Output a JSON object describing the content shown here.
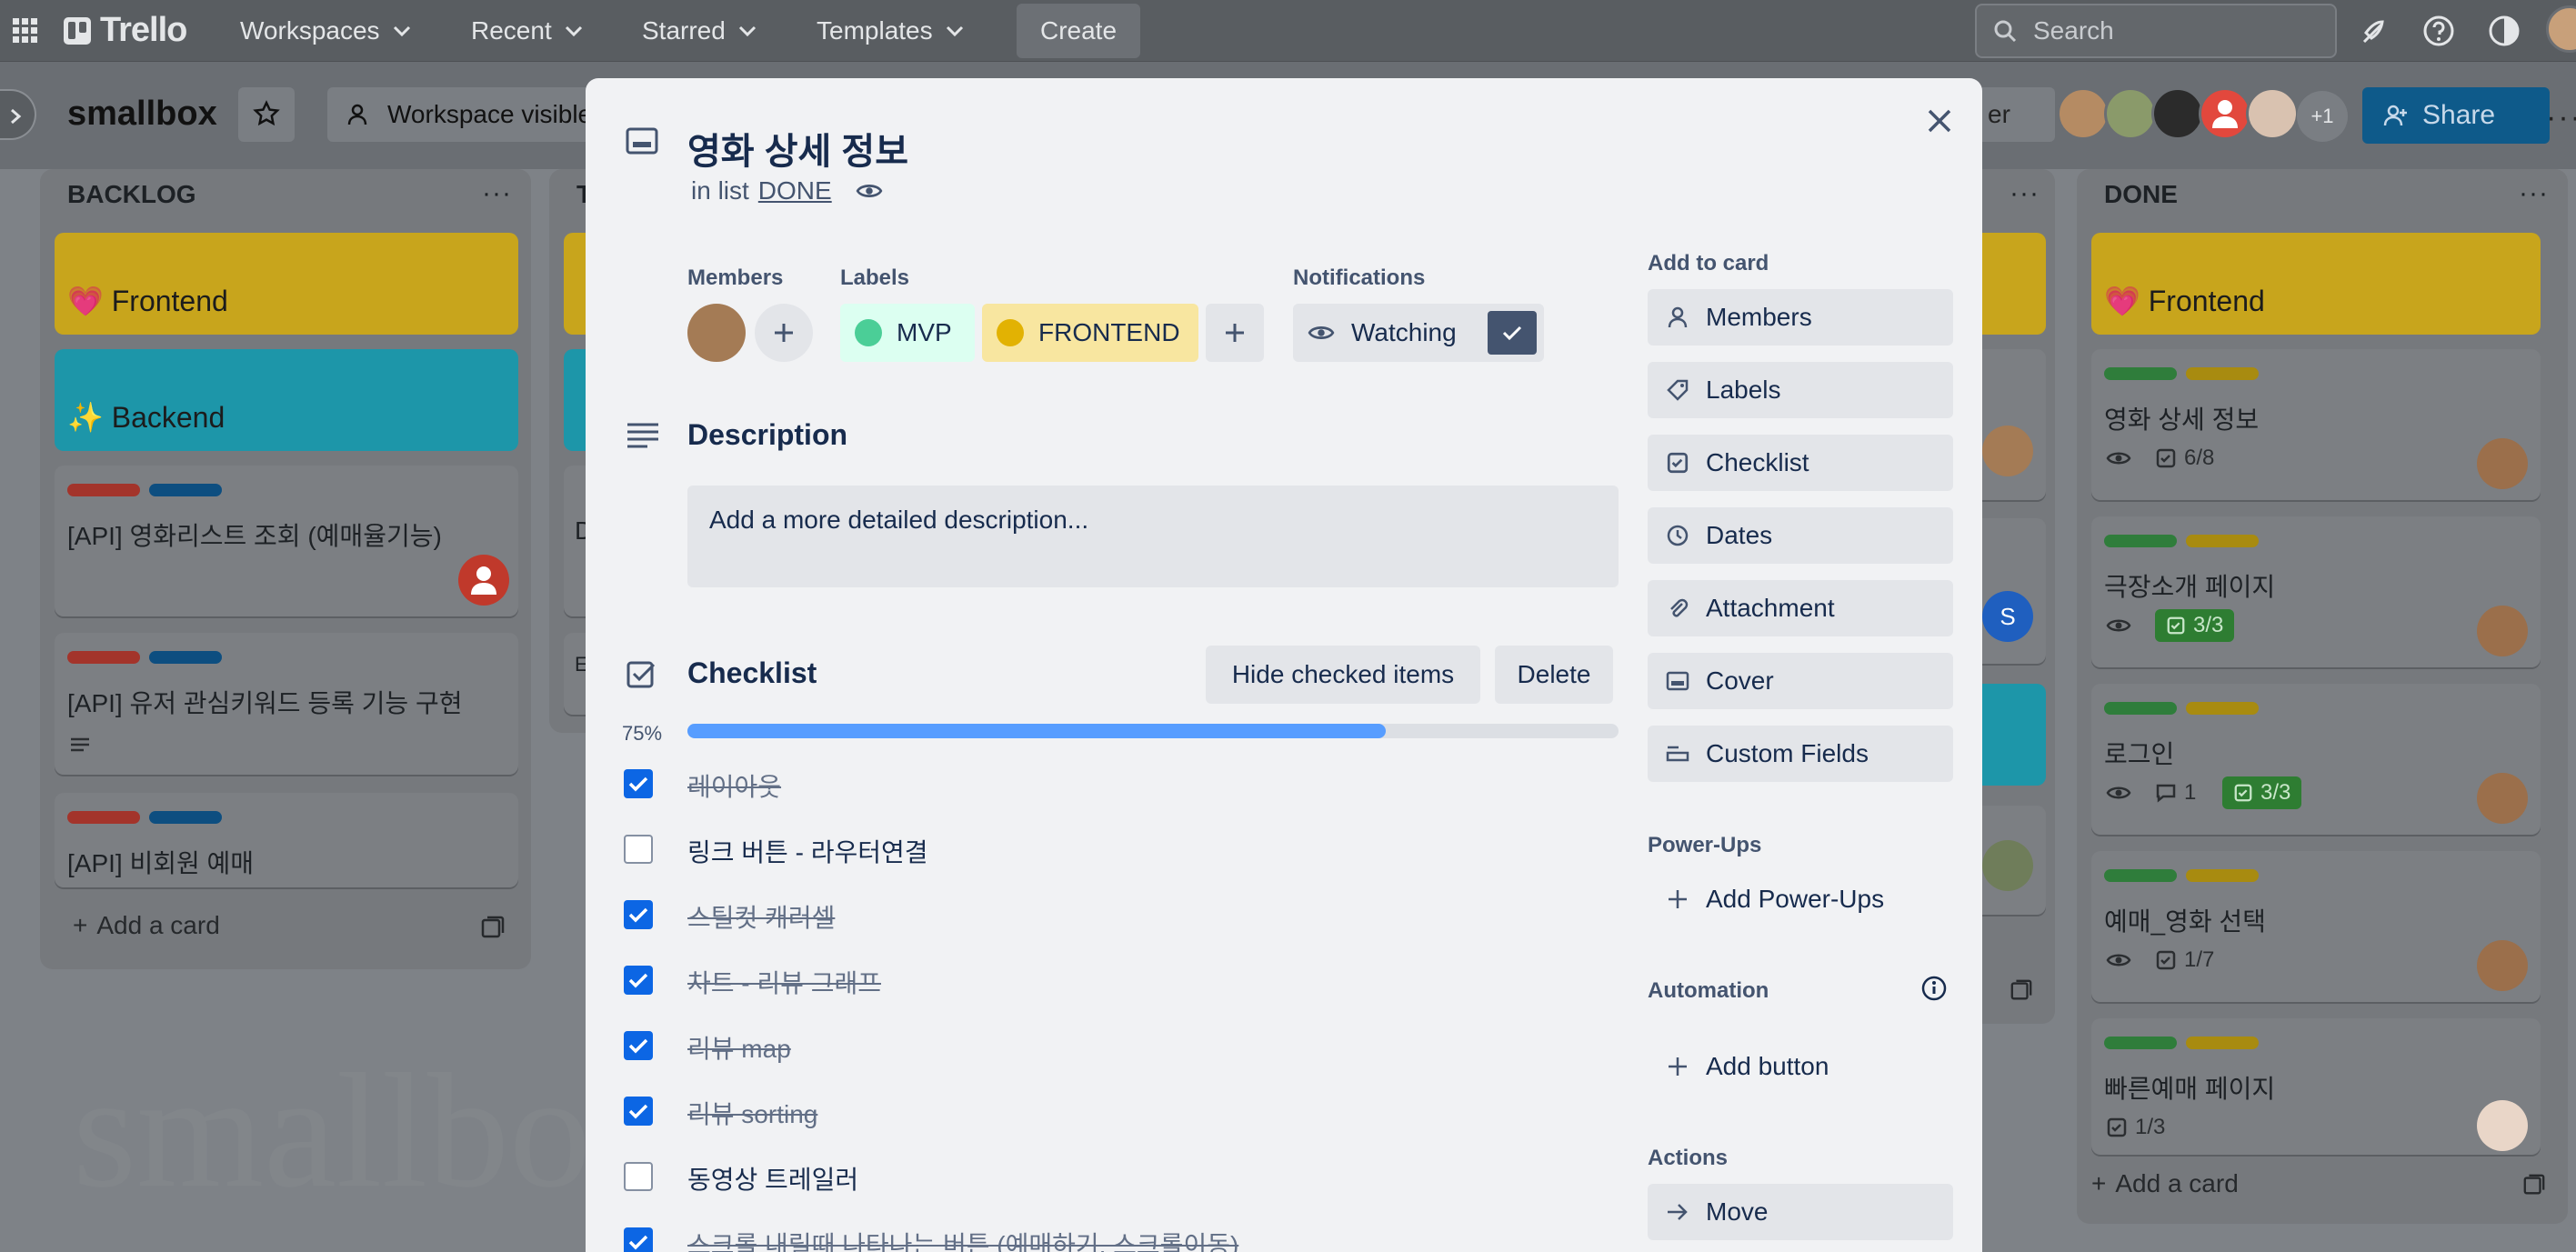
{
  "nav": {
    "logo": "Trello",
    "items": [
      "Workspaces",
      "Recent",
      "Starred",
      "Templates"
    ],
    "create": "Create",
    "search_placeholder": "Search"
  },
  "board": {
    "title": "smallbox",
    "visibility": "Workspace visible",
    "filter_partial": "er",
    "members_more": "+1",
    "share": "Share",
    "watermark": "smallbox"
  },
  "lists": {
    "backlog": {
      "title": "BACKLOG",
      "cards": [
        {
          "cover": "💗 Frontend",
          "cover_color": "#c8a51c"
        },
        {
          "cover": "✨ Backend",
          "cover_color": "#1d96a9"
        },
        {
          "text": "[API] 영화리스트 조회 (예매율기능)"
        },
        {
          "text": "[API] 유저 관심키워드 등록 기능 구현"
        },
        {
          "text": "[API] 비회원 예매"
        }
      ],
      "add": "Add a card"
    },
    "done": {
      "title": "DONE",
      "cards": [
        {
          "cover": "💗 Frontend"
        },
        {
          "text": "영화 상세 정보",
          "checklist": "6/8"
        },
        {
          "text": "극장소개 페이지",
          "checklist": "3/3"
        },
        {
          "text": "로그인",
          "comments": "1",
          "checklist": "3/3"
        },
        {
          "text": "예매_영화 선택",
          "checklist": "1/7"
        },
        {
          "text": "빠른예매 페이지",
          "checklist": "1/3"
        }
      ],
      "add": "Add a card"
    },
    "partial_letters": [
      "T",
      "D",
      "E"
    ]
  },
  "modal": {
    "title": "영화 상세 정보",
    "in_list_prefix": "in list",
    "list_name": "DONE",
    "members_label": "Members",
    "labels_label": "Labels",
    "notifications_label": "Notifications",
    "labels": [
      {
        "name": "MVP",
        "color": "#4bce97"
      },
      {
        "name": "FRONTEND",
        "color": "#e2b203"
      }
    ],
    "watching": "Watching",
    "description_title": "Description",
    "description_placeholder": "Add a more detailed description...",
    "checklist_title": "Checklist",
    "hide_checked": "Hide checked items",
    "delete": "Delete",
    "progress_label": "75%",
    "progress": 0.75,
    "checklist_items": [
      {
        "text": "레이아웃",
        "checked": true
      },
      {
        "text": "링크 버튼 - 라우터연결",
        "checked": false
      },
      {
        "text": "스틸컷 캐러셀",
        "checked": true
      },
      {
        "text": "차트 - 리뷰 그래프",
        "checked": true
      },
      {
        "text": "리뷰 map",
        "checked": true
      },
      {
        "text": "리뷰 sorting",
        "checked": true
      },
      {
        "text": "동영상 트레일러",
        "checked": false
      },
      {
        "text": "스크롤 내릴때 나타나는 버튼 (예매하기, 스크롤이동)",
        "checked": true
      }
    ],
    "sidebar": {
      "add_to_card": "Add to card",
      "buttons": [
        "Members",
        "Labels",
        "Checklist",
        "Dates",
        "Attachment",
        "Cover",
        "Custom Fields"
      ],
      "powerups_label": "Power-Ups",
      "add_powerups": "Add Power-Ups",
      "automation_label": "Automation",
      "add_button": "Add button",
      "actions_label": "Actions",
      "move": "Move"
    }
  }
}
